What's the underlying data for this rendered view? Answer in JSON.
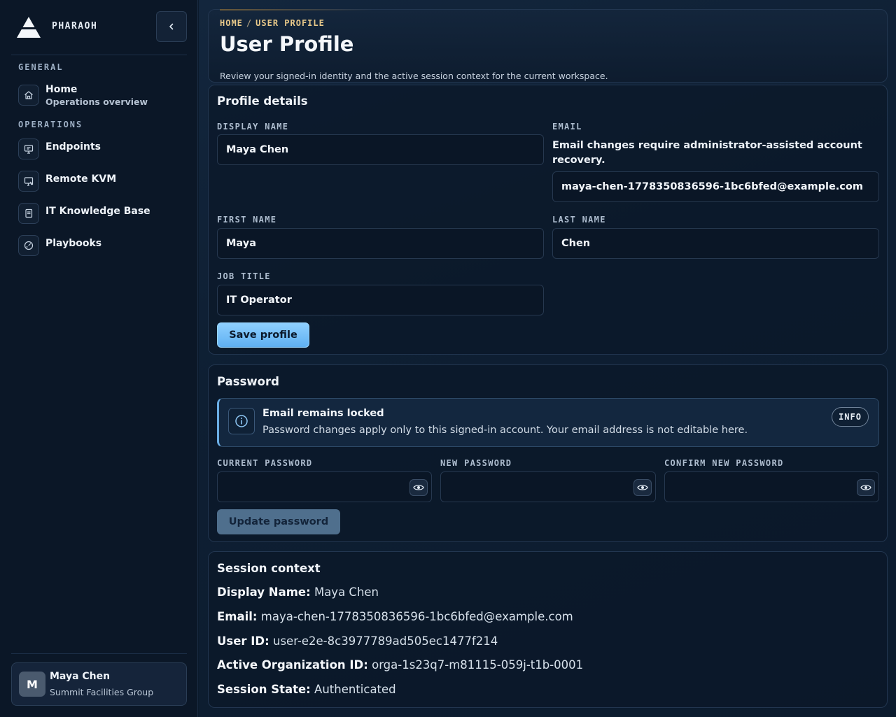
{
  "brand": {
    "name": "PHARAOH"
  },
  "sidebar": {
    "sections": [
      {
        "label": "GENERAL"
      },
      {
        "label": "OPERATIONS"
      }
    ],
    "items": [
      {
        "label": "Home",
        "sublabel": "Operations overview",
        "icon": "home-icon"
      },
      {
        "label": "Endpoints",
        "icon": "monitor-icon"
      },
      {
        "label": "Remote KVM",
        "icon": "remote-screen-icon"
      },
      {
        "label": "IT Knowledge Base",
        "icon": "book-icon"
      },
      {
        "label": "Playbooks",
        "icon": "gauge-icon"
      }
    ],
    "user": {
      "initial": "M",
      "name": "Maya Chen",
      "org": "Summit Facilities Group"
    }
  },
  "header": {
    "breadcrumb": [
      "HOME",
      "USER PROFILE"
    ],
    "breadcrumb_sep": "/",
    "title": "User Profile",
    "description": "Review your signed-in identity and the active session context for the current workspace."
  },
  "profile": {
    "title": "Profile details",
    "display_name": {
      "label": "DISPLAY NAME",
      "value": "Maya Chen"
    },
    "email": {
      "label": "EMAIL",
      "note": "Email changes require administrator-assisted account recovery.",
      "value": "maya-chen-1778350836596-1bc6bfed@example.com"
    },
    "first_name": {
      "label": "FIRST NAME",
      "value": "Maya"
    },
    "last_name": {
      "label": "LAST NAME",
      "value": "Chen"
    },
    "job_title": {
      "label": "JOB TITLE",
      "value": "IT Operator"
    },
    "save_label": "Save profile"
  },
  "password": {
    "title": "Password",
    "alert": {
      "title": "Email remains locked",
      "text": "Password changes apply only to this signed-in account. Your email address is not editable here.",
      "badge": "INFO"
    },
    "current": {
      "label": "CURRENT PASSWORD",
      "value": ""
    },
    "new": {
      "label": "NEW PASSWORD",
      "value": ""
    },
    "confirm": {
      "label": "CONFIRM NEW PASSWORD",
      "value": ""
    },
    "update_label": "Update password"
  },
  "session": {
    "title": "Session context",
    "rows": [
      {
        "key": "Display Name:",
        "value": "Maya Chen"
      },
      {
        "key": "Email:",
        "value": "maya-chen-1778350836596-1bc6bfed@example.com"
      },
      {
        "key": "User ID:",
        "value": "user-e2e-8c3977789ad505ec1477f214"
      },
      {
        "key": "Active Organization ID:",
        "value": "orga-1s23q7-m81115-059j-t1b-0001"
      },
      {
        "key": "Session State:",
        "value": "Authenticated"
      }
    ]
  },
  "colors": {
    "accent": "#6cbcf7",
    "breadcrumb": "#e8c98a",
    "background": "#0b1a2c"
  }
}
